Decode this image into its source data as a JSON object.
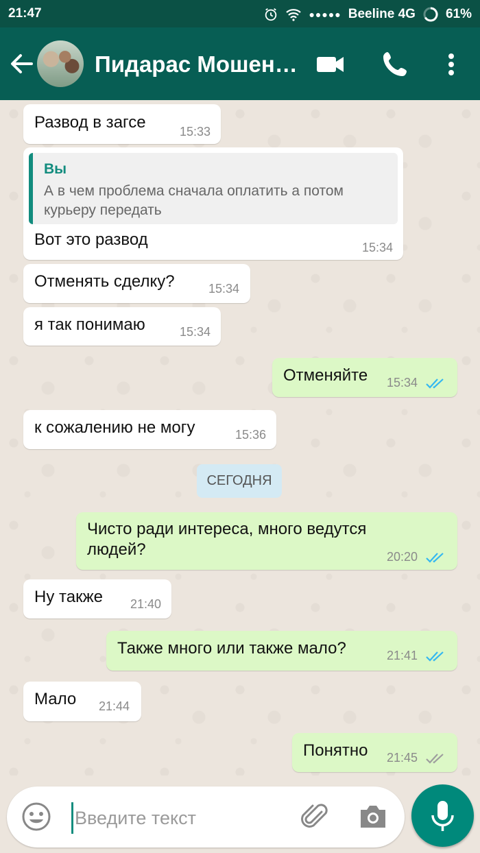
{
  "status_bar": {
    "time": "21:47",
    "carrier": "Beeline 4G",
    "battery": "61%",
    "icons": [
      "alarm-icon",
      "wifi-icon",
      "signal-dots-icon",
      "battery-icon"
    ]
  },
  "header": {
    "contact_name": "Пидарас Мошен…",
    "icons": [
      "back-arrow-icon",
      "avatar",
      "video-call-icon",
      "phone-icon",
      "more-vert-icon"
    ]
  },
  "messages": [
    {
      "dir": "in",
      "text": "Развод в загсе",
      "time": "15:33"
    },
    {
      "dir": "in",
      "quote_author": "Вы",
      "quote_text": "А в чем проблема сначала оплатить а потом курьеру передать",
      "text": "Вот это развод",
      "time": "15:34"
    },
    {
      "dir": "in",
      "text": "Отменять сделку?",
      "time": "15:34"
    },
    {
      "dir": "in",
      "text": "я так понимаю",
      "time": "15:34"
    },
    {
      "dir": "out",
      "text": "Отменяйте",
      "time": "15:34",
      "status": "read"
    },
    {
      "dir": "in",
      "text": "к сожалению не могу",
      "time": "15:36"
    },
    {
      "dir": "out",
      "text": "Чисто ради интереса, много ведутся людей?",
      "time": "20:20",
      "status": "read"
    },
    {
      "dir": "in",
      "text": "Ну также",
      "time": "21:40"
    },
    {
      "dir": "out",
      "text": "Также много или также мало?",
      "time": "21:41",
      "status": "read"
    },
    {
      "dir": "in",
      "text": "Мало",
      "time": "21:44"
    },
    {
      "dir": "out",
      "text": "Понятно",
      "time": "21:45",
      "status": "delivered"
    }
  ],
  "date_divider": "СЕГОДНЯ",
  "composer": {
    "placeholder": "Введите текст",
    "icons": [
      "emoji-icon",
      "attach-icon",
      "camera-icon",
      "mic-icon"
    ]
  },
  "colors": {
    "header": "#075e54",
    "status_bar": "#0b5145",
    "outgoing_bubble": "#dcf8c6",
    "incoming_bubble": "#ffffff",
    "read_ticks": "#34b7f1",
    "delivered_ticks": "#9e9e9e",
    "accent": "#00897b"
  }
}
